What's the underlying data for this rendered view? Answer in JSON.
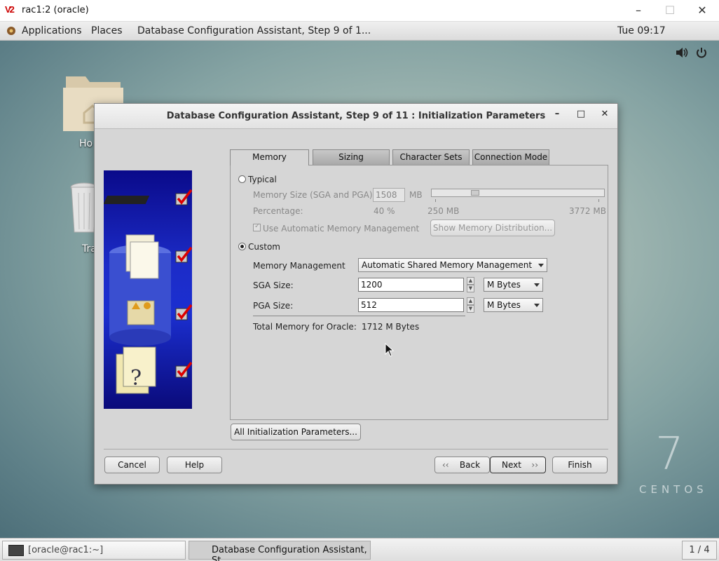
{
  "vnc": {
    "logo": "V2",
    "title": "rac1:2 (oracle)"
  },
  "topbar": {
    "applications": "Applications",
    "places": "Places",
    "window_title": "Database Configuration Assistant, Step 9 of 1...",
    "clock": "Tue 09:17"
  },
  "desktop": {
    "home_label": "Ho",
    "trash_label": "Tra",
    "centos_version": "7",
    "centos_text": "CENTOS"
  },
  "dialog": {
    "title": "Database Configuration Assistant, Step 9 of 11 : Initialization Parameters",
    "tabs": [
      {
        "label": "Memory"
      },
      {
        "label": "Sizing"
      },
      {
        "label": "Character Sets"
      },
      {
        "label": "Connection Mode"
      }
    ],
    "typical": {
      "label": "Typical",
      "memory_size_label": "Memory Size (SGA and PGA):",
      "memory_size_value": "1508",
      "memory_size_unit": "MB",
      "percentage_label": "Percentage:",
      "percentage_value": "40 %",
      "slider_fraction": 0.24,
      "slider_min": "250 MB",
      "slider_max": "3772 MB",
      "amm_label": "Use Automatic Memory Management",
      "show_distribution": "Show Memory Distribution..."
    },
    "custom": {
      "label": "Custom",
      "mm_label": "Memory Management",
      "mm_value": "Automatic Shared Memory Management",
      "sga_label": "SGA Size:",
      "sga_value": "1200",
      "sga_unit": "M Bytes",
      "pga_label": "PGA Size:",
      "pga_value": "512",
      "pga_unit": "M Bytes",
      "total_label": "Total Memory for Oracle:",
      "total_value": "1712 M Bytes"
    },
    "all_params_button": "All Initialization Parameters...",
    "buttons": {
      "cancel": "Cancel",
      "help": "Help",
      "back": "Back",
      "next": "Next",
      "finish": "Finish"
    }
  },
  "taskbar": {
    "terminal": "[oracle@rac1:~]",
    "dbca": "Database Configuration Assistant, St...",
    "pager": "1 / 4"
  }
}
